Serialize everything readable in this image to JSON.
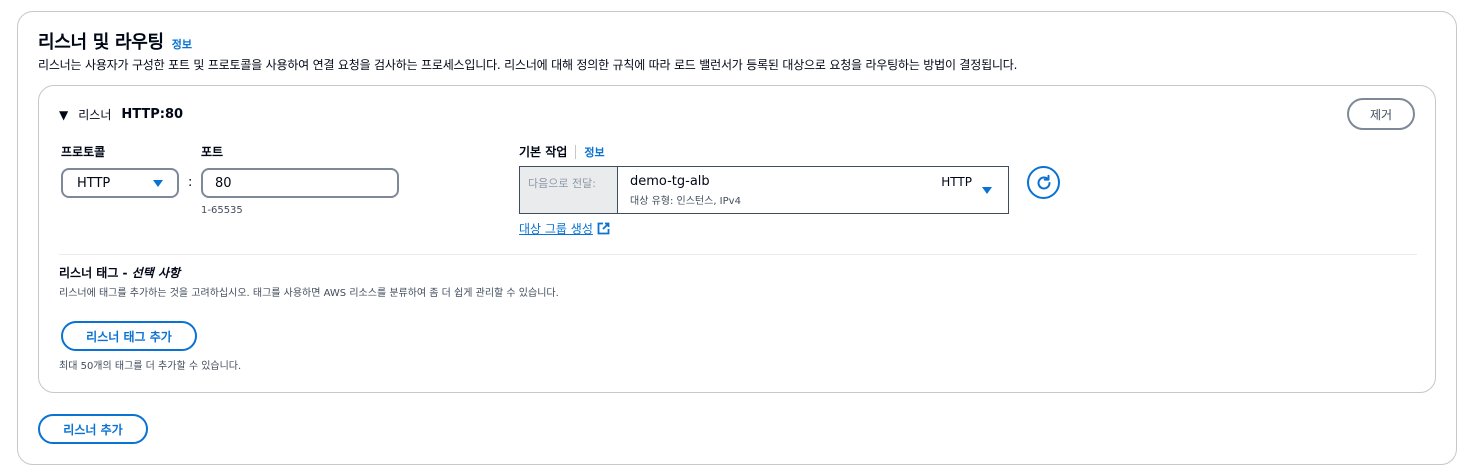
{
  "section": {
    "title": "리스너 및 라우팅",
    "info_label": "정보",
    "description": "리스너는 사용자가 구성한 포트 및 프로토콜을 사용하여 연결 요청을 검사하는 프로세스입니다. 리스너에 대해 정의한 규칙에 따라 로드 밸런서가 등록된 대상으로 요청을 라우팅하는 방법이 결정됩니다."
  },
  "listener": {
    "header_label": "리스너",
    "header_value": "HTTP:80",
    "remove_label": "제거",
    "protocol_label": "프로토콜",
    "protocol_value": "HTTP",
    "port_label": "포트",
    "port_value": "80",
    "port_hint": "1-65535",
    "default_action_label": "기본 작업",
    "default_action_info": "정보",
    "forward_prefix": "다음으로 전달:",
    "target_group_name": "demo-tg-alb",
    "target_group_protocol": "HTTP",
    "target_group_subtitle": "대상 유형: 인스턴스, IPv4",
    "create_target_group_label": "대상 그룹 생성"
  },
  "tags": {
    "title": "리스너 태그 -",
    "title_optional": "선택 사항",
    "description": "리스너에 태그를 추가하는 것을 고려하십시오. 태그를 사용하면 AWS 리소스를 분류하여 좀 더 쉽게 관리할 수 있습니다.",
    "add_button_label": "리스너 태그 추가",
    "limit_text": "최대 50개의 태그를 더 추가할 수 있습니다."
  },
  "add_listener_label": "리스너 추가",
  "colors": {
    "accent": "#0972d3",
    "border": "#c6c6cd",
    "text": "#000716"
  }
}
